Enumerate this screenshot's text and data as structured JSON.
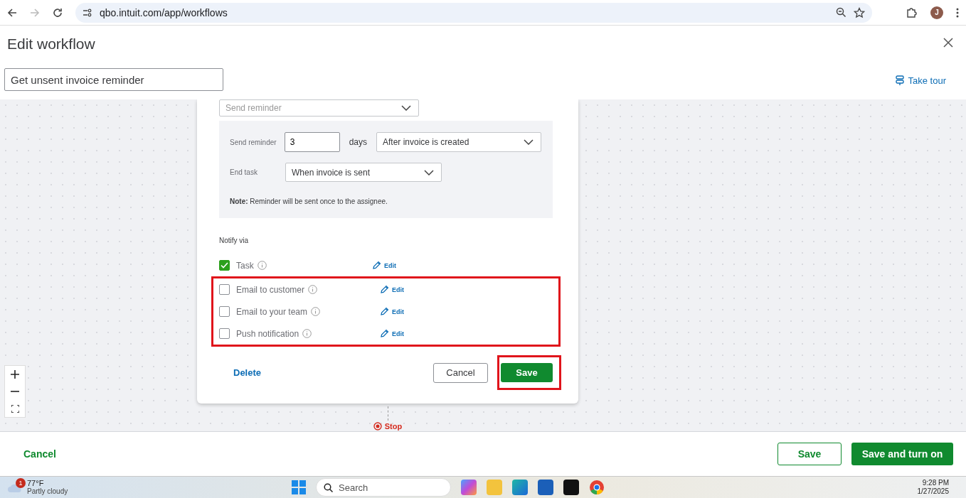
{
  "browser": {
    "url": "qbo.intuit.com/app/workflows",
    "avatar": "J"
  },
  "header": {
    "title": "Edit workflow",
    "workflow_name": "Get unsent invoice reminder",
    "take_tour": "Take tour"
  },
  "card": {
    "action_select": "Send reminder",
    "reminder": {
      "label": "Send reminder",
      "days_value": "3",
      "days_unit": "days",
      "timing": "After invoice is created"
    },
    "end_task": {
      "label": "End task",
      "value": "When invoice is sent"
    },
    "note": "**Note:** Reminder will be sent once to the assignee.",
    "notify_label": "Notify via",
    "notify_options": [
      {
        "label": "Task",
        "checked": true,
        "edit": "Edit",
        "highlighted": false
      },
      {
        "label": "Email to customer",
        "checked": false,
        "edit": "Edit",
        "highlighted": true
      },
      {
        "label": "Email to your team",
        "checked": false,
        "edit": "Edit",
        "highlighted": true
      },
      {
        "label": "Push notification",
        "checked": false,
        "edit": "Edit",
        "highlighted": true
      }
    ],
    "delete": "Delete",
    "cancel": "Cancel",
    "save": "Save",
    "save_highlighted": true
  },
  "flow": {
    "stop": "Stop"
  },
  "footer": {
    "cancel": "Cancel",
    "save": "Save",
    "save_and_turn_on": "Save and turn on"
  },
  "taskbar": {
    "temperature": "77°F",
    "condition": "Partly cloudy",
    "weather_badge": "1",
    "search": "Search",
    "time": "9:28 PM",
    "date": "1/27/2025"
  }
}
